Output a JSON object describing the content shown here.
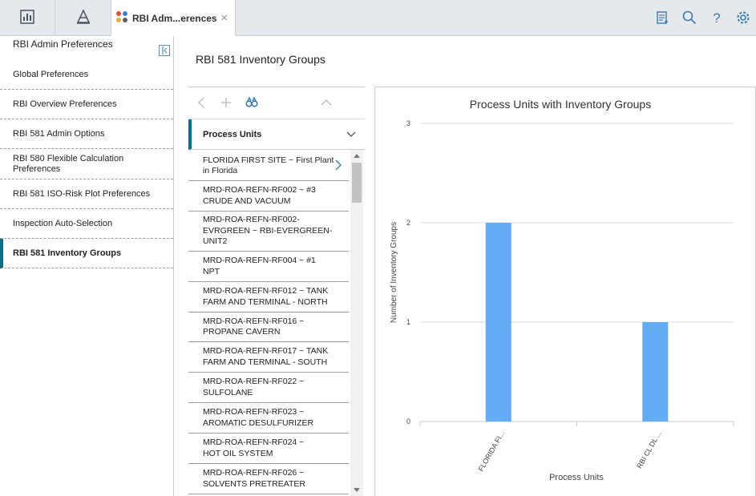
{
  "tab": {
    "label": "RBI Adm...erences",
    "close": "×"
  },
  "toolbar_icons": [
    "dashboard-icon",
    "hierarchy-icon",
    "app-tab-icon",
    "notes-icon",
    "search-icon",
    "help-icon",
    "settings-icon"
  ],
  "leftnav": {
    "header": "RBI Admin Preferences",
    "items": [
      "Global Preferences",
      "RBI Overview Preferences",
      "RBI 581 Admin Options",
      "RBI 580 Flexible Calculation Preferences",
      "RBI 581 ISO-Risk Plot Preferences",
      "Inspection Auto-Selection",
      "RBI 581 Inventory Groups"
    ],
    "active_index": 6
  },
  "main": {
    "title": "RBI 581 Inventory Groups"
  },
  "list": {
    "header": "Process Units",
    "rows": [
      "FLORIDA FIRST SITE ~ First Plant in Florida",
      "MRD-ROA-REFN-RF002 ~ #3 CRUDE AND VACUUM",
      "MRD-ROA-REFN-RF002-EVRGREEN ~ RBI-EVERGREEN-UNIT2",
      "MRD-ROA-REFN-RF004 ~ #1 NPT",
      "MRD-ROA-REFN-RF012 ~ TANK FARM AND TERMINAL - NORTH",
      "MRD-ROA-REFN-RF016 ~ PROPANE CAVERN",
      "MRD-ROA-REFN-RF017 ~ TANK FARM AND TERMINAL - SOUTH",
      "MRD-ROA-REFN-RF022 ~ SULFOLANE",
      "MRD-ROA-REFN-RF023 ~ AROMATIC DESULFURIZER",
      "MRD-ROA-REFN-RF024 ~ HOT OIL SYSTEM",
      "MRD-ROA-REFN-RF026 ~ SOLVENTS PRETREATER"
    ]
  },
  "chart_data": {
    "type": "bar",
    "title": "Process Units with Inventory Groups",
    "xlabel": "Process Units",
    "ylabel": "Number of Inventory Groups",
    "categories": [
      "FLORIDA FI...",
      "RBI CL DL ..."
    ],
    "values": [
      2,
      1
    ],
    "ylim": [
      0,
      3
    ],
    "yticks": [
      0,
      1,
      2,
      3
    ],
    "bar_color": "#64abf5",
    "grid": true
  }
}
